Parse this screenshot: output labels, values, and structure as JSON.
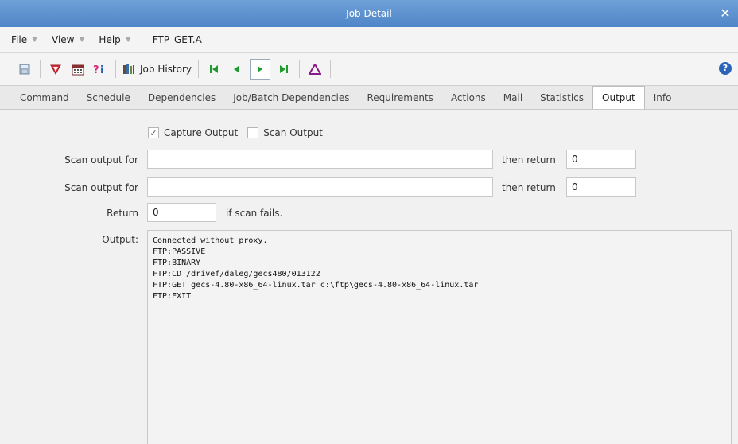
{
  "window": {
    "title": "Job Detail",
    "close": "✕"
  },
  "menubar": {
    "menus": [
      "File",
      "View",
      "Help"
    ],
    "job_name": "FTP_GET.A"
  },
  "toolbar": {
    "job_history_label": "Job History",
    "icons": [
      "save-icon",
      "filter-icon",
      "calendar-icon",
      "variables-icon",
      "job-history-icon",
      "first-icon",
      "previous-icon",
      "next-icon",
      "last-icon",
      "delta-icon",
      "help-icon"
    ],
    "help": "?"
  },
  "tabs": {
    "items": [
      "Command",
      "Schedule",
      "Dependencies",
      "Job/Batch Dependencies",
      "Requirements",
      "Actions",
      "Mail",
      "Statistics",
      "Output",
      "Info"
    ],
    "active": "Output"
  },
  "output_tab": {
    "capture_output": {
      "label": "Capture Output",
      "checked": true
    },
    "scan_output": {
      "label": "Scan Output",
      "checked": false
    },
    "scan_rows": [
      {
        "label": "Scan output for",
        "value": "",
        "then_label": "then return",
        "return_value": "0"
      },
      {
        "label": "Scan output for",
        "value": "",
        "then_label": "then return",
        "return_value": "0"
      }
    ],
    "return_label": "Return",
    "return_value": "0",
    "fail_note": "if scan fails.",
    "output_label": "Output:",
    "output_lines": [
      "Connected without proxy.",
      "FTP:PASSIVE",
      "FTP:BINARY",
      "FTP:CD /drivef/daleg/gecs480/013122",
      "FTP:GET gecs-4.80-x86_64-linux.tar c:\\ftp\\gecs-4.80-x86_64-linux.tar",
      "FTP:EXIT"
    ]
  }
}
